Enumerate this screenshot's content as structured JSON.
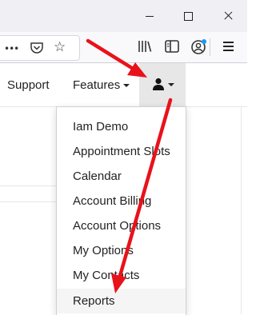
{
  "nav": {
    "support": "Support",
    "features": "Features"
  },
  "dropdown": {
    "items": [
      {
        "label": "Iam Demo"
      },
      {
        "label": "Appointment Slots"
      },
      {
        "label": "Calendar"
      },
      {
        "label": "Account Billing"
      },
      {
        "label": "Account Options"
      },
      {
        "label": "My Options"
      },
      {
        "label": "My Contacts"
      },
      {
        "label": "Reports"
      }
    ],
    "highlighted": "Reports"
  },
  "icons": {
    "toolbar": [
      "more-dots-icon",
      "pocket-icon",
      "bookmark-star-icon",
      "library-icon",
      "sidebar-icon",
      "account-icon",
      "hamburger-menu-icon"
    ],
    "nav": [
      "user-icon",
      "caret-down-icon"
    ]
  },
  "colors": {
    "annotation_arrow": "#e8121b",
    "account_badge": "#1a9af5",
    "dropdown_hover": "#f5f5f5",
    "user_menu_bg": "#e7e7e7"
  }
}
